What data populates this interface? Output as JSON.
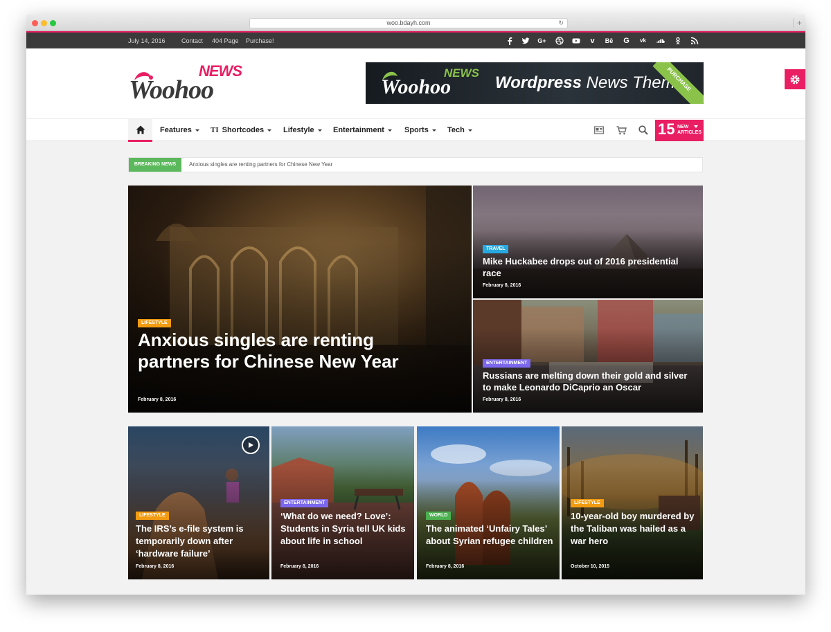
{
  "browser": {
    "url": "woo.bdayh.com"
  },
  "topbar": {
    "date": "July 14, 2016",
    "links": [
      "Contact",
      "404 Page",
      "Purchase!"
    ],
    "social_icons": [
      "facebook-icon",
      "twitter-icon",
      "google-plus-icon",
      "dribbble-icon",
      "youtube-icon",
      "vimeo-icon",
      "behance-icon",
      "google-icon",
      "vk-icon",
      "soundcloud-icon",
      "odnoklassniki-icon",
      "rss-icon"
    ]
  },
  "logo": {
    "small": "NEWS",
    "main": "Woohoo"
  },
  "banner": {
    "logo_small": "NEWS",
    "logo_main": "Woohoo",
    "tagline_bold": "Wordpress",
    "tagline": " News Theme",
    "ribbon": "PURCHASE"
  },
  "nav": {
    "items": [
      "Features",
      "Shortcodes",
      "Lifestyle",
      "Entertainment",
      "Sports",
      "Tech"
    ],
    "new_count": "15",
    "new_label_1": "NEW",
    "new_label_2": "ARTICLES"
  },
  "breaking": {
    "label": "BREAKING NEWS",
    "text": "Anxious singles are renting partners for Chinese New Year"
  },
  "featured": {
    "main": {
      "tag": "LIFESTYLE",
      "title": "Anxious singles are renting partners for Chinese New Year",
      "date": "February 8, 2016"
    },
    "side": [
      {
        "tag": "TRAVEL",
        "title": "Mike Huckabee drops out of 2016 presidential race",
        "date": "February 8, 2016"
      },
      {
        "tag": "ENTERTAINMENT",
        "title": "Russians are melting down their gold and silver to make Leonardo DiCaprio an Oscar",
        "date": "February 8, 2016"
      }
    ]
  },
  "grid": [
    {
      "tag": "LIFESTYLE",
      "title": "The IRS’s e-file system is temporarily down after ‘hardware failure’",
      "date": "February 8, 2016"
    },
    {
      "tag": "ENTERTAINMENT",
      "title": "‘What do we need? Love’: Students in Syria tell UK kids about life in school",
      "date": "February 8, 2016"
    },
    {
      "tag": "WORLD",
      "title": "The animated ‘Unfairy Tales’ about Syrian refugee children",
      "date": "February 8, 2016"
    },
    {
      "tag": "LIFESTYLE",
      "title": "10-year-old boy murdered by the Taliban was hailed as a war hero",
      "date": "October 10, 2015"
    }
  ],
  "colors": {
    "accent": "#e91e63",
    "breaking": "#5cb85c",
    "tag_lifestyle": "#f39c12",
    "tag_travel": "#29a9e1",
    "tag_entertainment": "#7b68ee",
    "tag_world": "#4caf50"
  }
}
